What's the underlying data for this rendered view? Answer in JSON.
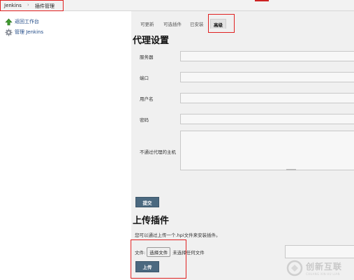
{
  "breadcrumb": {
    "root": "Jenkins",
    "separator": "›",
    "current": "插件管理"
  },
  "sidebar": {
    "items": [
      {
        "label": "返回工作台",
        "icon": "up-arrow-icon"
      },
      {
        "label": "管理 Jenkins",
        "icon": "gear-icon"
      }
    ]
  },
  "tabs": [
    {
      "label": "可更新",
      "active": false
    },
    {
      "label": "可选插件",
      "active": false
    },
    {
      "label": "已安装",
      "active": false
    },
    {
      "label": "高级",
      "active": true
    }
  ],
  "proxy": {
    "title": "代理设置",
    "fields": {
      "server": {
        "label": "服务器",
        "value": ""
      },
      "port": {
        "label": "端口",
        "value": ""
      },
      "username": {
        "label": "用户名",
        "value": ""
      },
      "password": {
        "label": "密码",
        "value": ""
      },
      "no_proxy": {
        "label": "不通过代理的主机",
        "value": ""
      }
    },
    "submit_label": "提交"
  },
  "upload": {
    "title": "上传插件",
    "hint": "您可以通过上传一个.hpi文件来安装插件。",
    "file_label": "文件:",
    "choose_label": "选择文件",
    "no_file": "未选择任何文件",
    "upload_label": "上传"
  },
  "watermark": {
    "main": "创新互联",
    "sub": "CHUANG XIN HU LIAN"
  },
  "colors": {
    "button": "#4b6980",
    "annotation": "#e02020",
    "link": "#204a87",
    "panel": "#f0f0f0"
  }
}
